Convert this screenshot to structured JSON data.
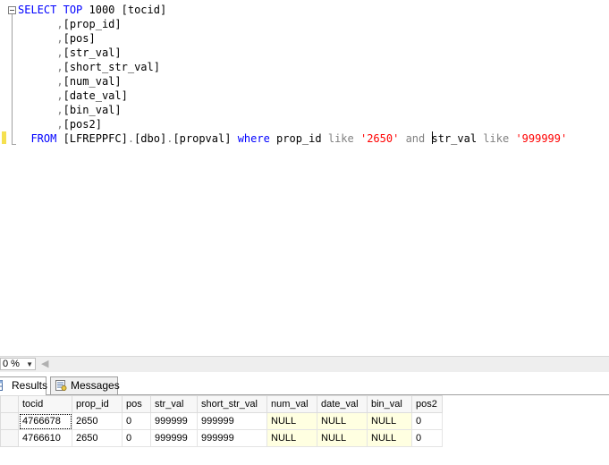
{
  "editor": {
    "lines": [
      {
        "parts": [
          {
            "t": "SELECT",
            "c": "kw"
          },
          {
            "t": " "
          },
          {
            "t": "TOP",
            "c": "kw"
          },
          {
            "t": " 1000 [tocid]"
          }
        ]
      },
      {
        "parts": [
          {
            "t": "      "
          },
          {
            "t": ",",
            "c": "op"
          },
          {
            "t": "[prop_id]"
          }
        ]
      },
      {
        "parts": [
          {
            "t": "      "
          },
          {
            "t": ",",
            "c": "op"
          },
          {
            "t": "[pos]"
          }
        ]
      },
      {
        "parts": [
          {
            "t": "      "
          },
          {
            "t": ",",
            "c": "op"
          },
          {
            "t": "[str_val]"
          }
        ]
      },
      {
        "parts": [
          {
            "t": "      "
          },
          {
            "t": ",",
            "c": "op"
          },
          {
            "t": "[short_str_val]"
          }
        ]
      },
      {
        "parts": [
          {
            "t": "      "
          },
          {
            "t": ",",
            "c": "op"
          },
          {
            "t": "[num_val]"
          }
        ]
      },
      {
        "parts": [
          {
            "t": "      "
          },
          {
            "t": ",",
            "c": "op"
          },
          {
            "t": "[date_val]"
          }
        ]
      },
      {
        "parts": [
          {
            "t": "      "
          },
          {
            "t": ",",
            "c": "op"
          },
          {
            "t": "[bin_val]"
          }
        ]
      },
      {
        "parts": [
          {
            "t": "      "
          },
          {
            "t": ",",
            "c": "op"
          },
          {
            "t": "[pos2]"
          }
        ]
      },
      {
        "parts": [
          {
            "t": "  "
          },
          {
            "t": "FROM",
            "c": "kw"
          },
          {
            "t": " [LFREPPFC]"
          },
          {
            "t": ".",
            "c": "op"
          },
          {
            "t": "[dbo]"
          },
          {
            "t": ".",
            "c": "op"
          },
          {
            "t": "[propval] "
          },
          {
            "t": "where",
            "c": "kw"
          },
          {
            "t": " prop_id "
          },
          {
            "t": "like",
            "c": "op"
          },
          {
            "t": " "
          },
          {
            "t": "'2650'",
            "c": "str"
          },
          {
            "t": " "
          },
          {
            "t": "and",
            "c": "op"
          },
          {
            "t": " "
          },
          {
            "t": "CARET"
          },
          {
            "t": "str_val "
          },
          {
            "t": "like",
            "c": "op"
          },
          {
            "t": " "
          },
          {
            "t": "'999999'",
            "c": "str"
          }
        ]
      }
    ]
  },
  "zoom": {
    "value": "0 %",
    "arrow": "▼",
    "scroll_left": "◀"
  },
  "tabs": {
    "results": "Results",
    "messages": "Messages"
  },
  "grid": {
    "columns": [
      "tocid",
      "prop_id",
      "pos",
      "str_val",
      "short_str_val",
      "num_val",
      "date_val",
      "bin_val",
      "pos2"
    ],
    "rows": [
      [
        "4766678",
        "2650",
        "0",
        "999999",
        "999999",
        "NULL",
        "NULL",
        "NULL",
        "0"
      ],
      [
        "4766610",
        "2650",
        "0",
        "999999",
        "999999",
        "NULL",
        "NULL",
        "NULL",
        "0"
      ]
    ]
  }
}
